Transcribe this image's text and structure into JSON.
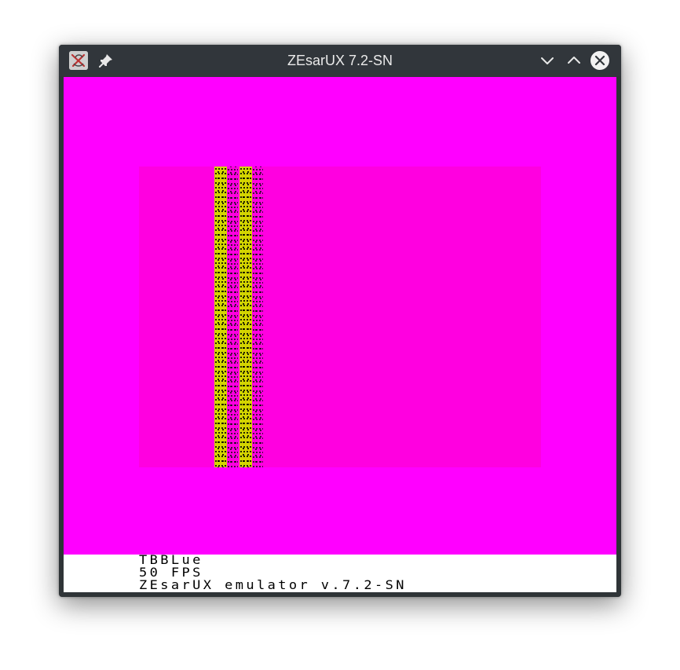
{
  "window": {
    "title": "ZEsarUX 7.2-SN"
  },
  "titlebar": {
    "app_icon": "zesarux-app-icon",
    "pin_icon": "pin-icon",
    "minimize_icon": "chevron-down-icon",
    "maximize_icon": "chevron-up-icon",
    "close_icon": "close-icon"
  },
  "screen": {
    "border_color": "#ff00ff",
    "paper_color": "#ff00e0",
    "bar_color": "#d4d400"
  },
  "footer": {
    "machine": "TBBLue",
    "fps": "50 FPS",
    "version": "ZEsarUX emulator v.7.2-SN"
  }
}
